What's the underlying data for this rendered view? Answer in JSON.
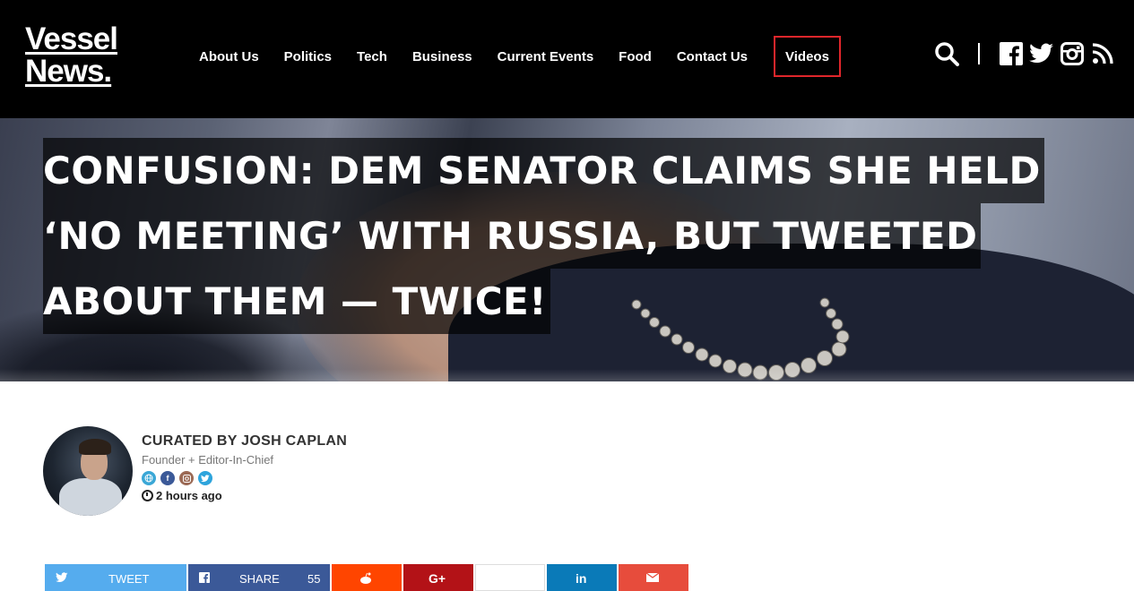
{
  "logo": {
    "line1": "Vessel",
    "line2": "News."
  },
  "nav": {
    "items": [
      {
        "label": "About Us"
      },
      {
        "label": "Politics"
      },
      {
        "label": "Tech"
      },
      {
        "label": "Business"
      },
      {
        "label": "Current Events"
      },
      {
        "label": "Food"
      },
      {
        "label": "Contact Us"
      },
      {
        "label": "Videos"
      }
    ]
  },
  "header_icons": [
    "search-icon",
    "facebook-icon",
    "twitter-icon",
    "instagram-icon",
    "rss-icon"
  ],
  "article": {
    "headline_lines": [
      "CONFUSION: DEM SENATOR CLAIMS SHE HELD",
      "‘NO MEETING’ WITH RUSSIA, BUT TWEETED",
      "ABOUT THEM — TWICE!"
    ]
  },
  "author": {
    "name": "CURATED BY JOSH CAPLAN",
    "role": "Founder + Editor-In-Chief",
    "time": "2 hours ago",
    "social": [
      "globe-icon",
      "facebook-icon",
      "instagram-icon",
      "twitter-icon"
    ]
  },
  "share": {
    "tweet_label": "TWEET",
    "share_label": "SHARE",
    "share_count": "55",
    "buttons": [
      "twitter",
      "facebook",
      "reddit",
      "google-plus",
      "blank",
      "linkedin",
      "email"
    ]
  },
  "colors": {
    "accent_red": "#e0262b",
    "twitter": "#55acee",
    "facebook": "#3b5998",
    "reddit": "#ff4500",
    "google_plus": "#b31217",
    "linkedin": "#0a7ab8",
    "email": "#e74c3c"
  }
}
